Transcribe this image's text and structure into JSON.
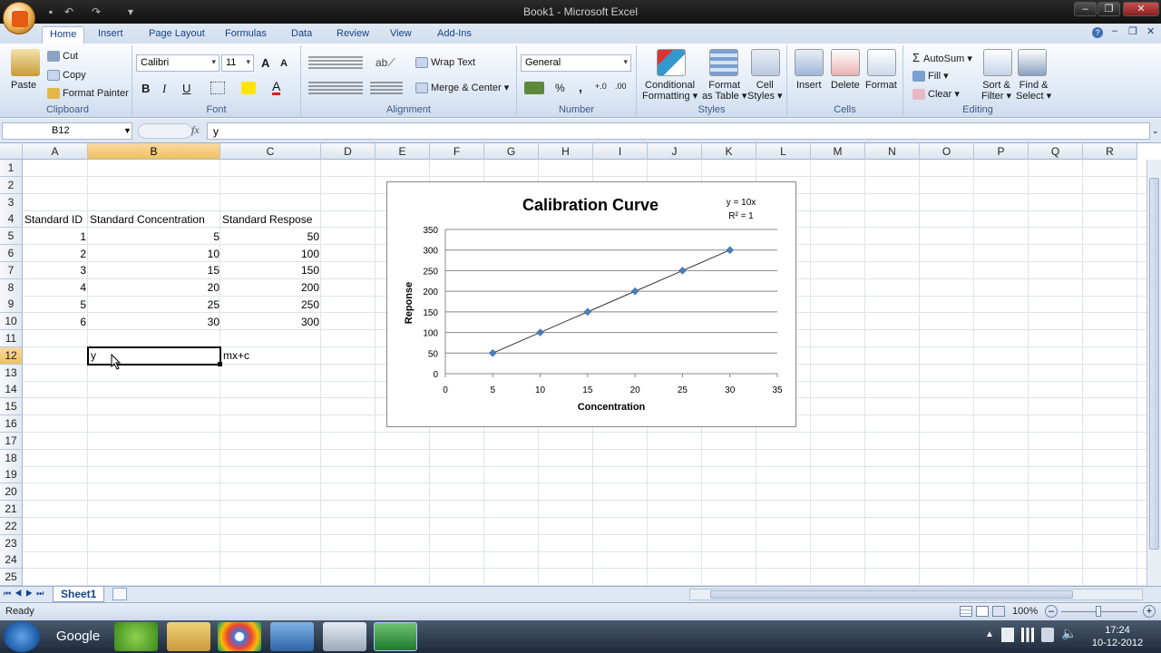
{
  "window": {
    "title": "Book1 - Microsoft Excel"
  },
  "ribbon": {
    "tabs": [
      "Home",
      "Insert",
      "Page Layout",
      "Formulas",
      "Data",
      "Review",
      "View",
      "Add-Ins"
    ],
    "clipboard": {
      "paste": "Paste",
      "cut": "Cut",
      "copy": "Copy",
      "format_painter": "Format Painter",
      "label": "Clipboard"
    },
    "font": {
      "name": "Calibri",
      "size": "11",
      "bold": "B",
      "italic": "I",
      "underline": "U",
      "label": "Font"
    },
    "alignment": {
      "wrap_text": "Wrap Text",
      "merge_center": "Merge & Center",
      "label": "Alignment"
    },
    "number": {
      "format": "General",
      "percent": "%",
      "comma": ",",
      "label": "Number"
    },
    "styles": {
      "conditional": "Conditional",
      "conditional2": "Formatting",
      "format_table": "Format",
      "format_table2": "as Table",
      "cell_styles": "Cell",
      "cell_styles2": "Styles",
      "label": "Styles"
    },
    "cells": {
      "insert": "Insert",
      "delete": "Delete",
      "format": "Format",
      "label": "Cells"
    },
    "editing": {
      "autosum": "AutoSum",
      "fill": "Fill",
      "clear": "Clear",
      "sort": "Sort &",
      "sort2": "Filter",
      "find": "Find &",
      "find2": "Select",
      "label": "Editing"
    }
  },
  "formula_bar": {
    "name_box": "B12",
    "fx": "fx",
    "content": "y"
  },
  "columns": [
    "A",
    "B",
    "C",
    "D",
    "E",
    "F",
    "G",
    "H",
    "I",
    "J",
    "K",
    "L",
    "M",
    "N",
    "O",
    "P",
    "Q",
    "R"
  ],
  "rows": [
    "1",
    "2",
    "3",
    "4",
    "5",
    "6",
    "7",
    "8",
    "9",
    "10",
    "11",
    "12",
    "13",
    "14",
    "15",
    "16",
    "17",
    "18",
    "19",
    "20",
    "21",
    "22",
    "23",
    "24",
    "25"
  ],
  "sheet": {
    "headers": {
      "a4": "Standard ID",
      "b4": "Standard Concentration",
      "c4": "Standard Respose"
    },
    "data": [
      {
        "id": "1",
        "conc": "5",
        "resp": "50"
      },
      {
        "id": "2",
        "conc": "10",
        "resp": "100"
      },
      {
        "id": "3",
        "conc": "15",
        "resp": "150"
      },
      {
        "id": "4",
        "conc": "20",
        "resp": "200"
      },
      {
        "id": "5",
        "conc": "25",
        "resp": "250"
      },
      {
        "id": "6",
        "conc": "30",
        "resp": "300"
      }
    ],
    "b12": "y",
    "c12": "mx+c"
  },
  "chart_data": {
    "type": "scatter",
    "title": "Calibration Curve",
    "xlabel": "Concentration",
    "ylabel": "Reponse",
    "x": [
      5,
      10,
      15,
      20,
      25,
      30
    ],
    "y": [
      50,
      100,
      150,
      200,
      250,
      300
    ],
    "xlim": [
      0,
      35
    ],
    "ylim": [
      0,
      350
    ],
    "xticks": [
      "0",
      "5",
      "10",
      "15",
      "20",
      "25",
      "30",
      "35"
    ],
    "yticks": [
      "0",
      "50",
      "100",
      "150",
      "200",
      "250",
      "300",
      "350"
    ],
    "trendline": {
      "equation": "y = 10x",
      "r2": "R² = 1"
    },
    "grid": "horizontal",
    "series_color": "#4a7ebb"
  },
  "sheet_tabs": {
    "active": "Sheet1"
  },
  "status": {
    "mode": "Ready",
    "zoom": "100%"
  },
  "taskbar": {
    "google_label": "Google",
    "time": "17:24",
    "date": "10-12-2012"
  }
}
